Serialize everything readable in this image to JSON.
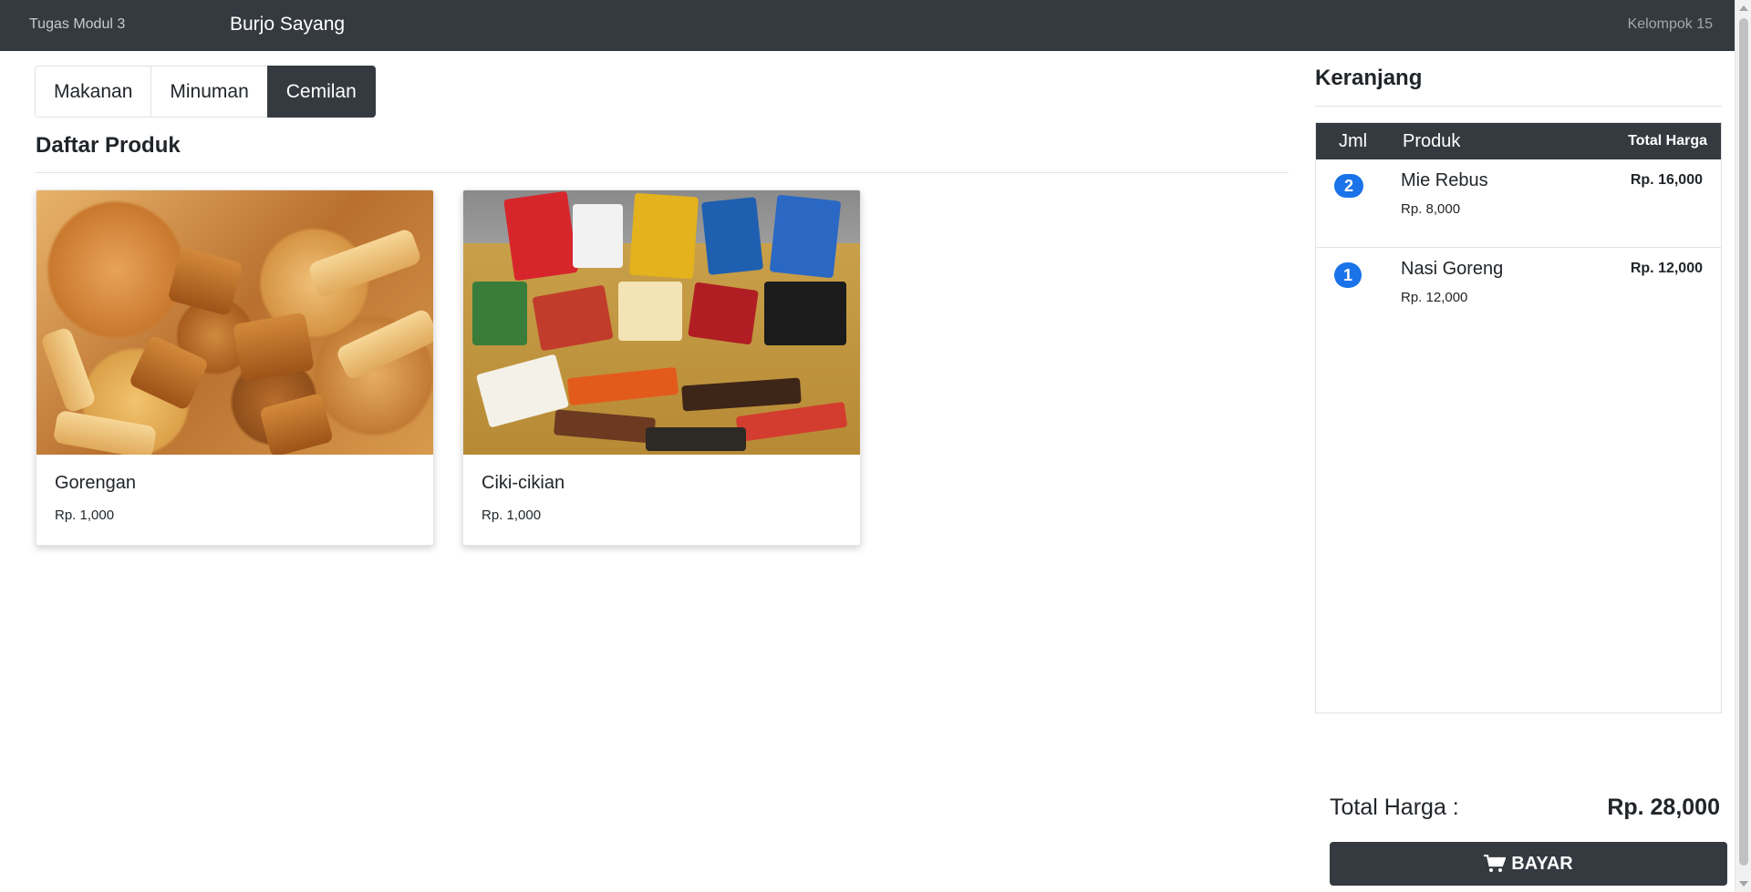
{
  "navbar": {
    "left_text": "Tugas Modul 3",
    "brand": "Burjo Sayang",
    "right_text": "Kelompok 15"
  },
  "categories": [
    {
      "label": "Makanan",
      "active": false
    },
    {
      "label": "Minuman",
      "active": false
    },
    {
      "label": "Cemilan",
      "active": true
    }
  ],
  "products_section": {
    "title": "Daftar Produk",
    "items": [
      {
        "name": "Gorengan",
        "price": "Rp. 1,000",
        "image": "fried-snacks-photo"
      },
      {
        "name": "Ciki-cikian",
        "price": "Rp. 1,000",
        "image": "packaged-chips-photo"
      }
    ]
  },
  "cart": {
    "title": "Keranjang",
    "headers": {
      "qty": "Jml",
      "product": "Produk",
      "total": "Total Harga"
    },
    "items": [
      {
        "qty": "2",
        "name": "Mie Rebus",
        "unit_price": "Rp. 8,000",
        "total": "Rp. 16,000"
      },
      {
        "qty": "1",
        "name": "Nasi Goreng",
        "unit_price": "Rp. 12,000",
        "total": "Rp. 12,000"
      }
    ],
    "total_label": "Total Harga :",
    "total_value": "Rp. 28,000",
    "pay_label": "BAYAR",
    "pay_icon": "cart-icon"
  },
  "colors": {
    "navbar": "#343a40",
    "active_button": "#343a40",
    "qty_badge": "#1a73e8"
  }
}
